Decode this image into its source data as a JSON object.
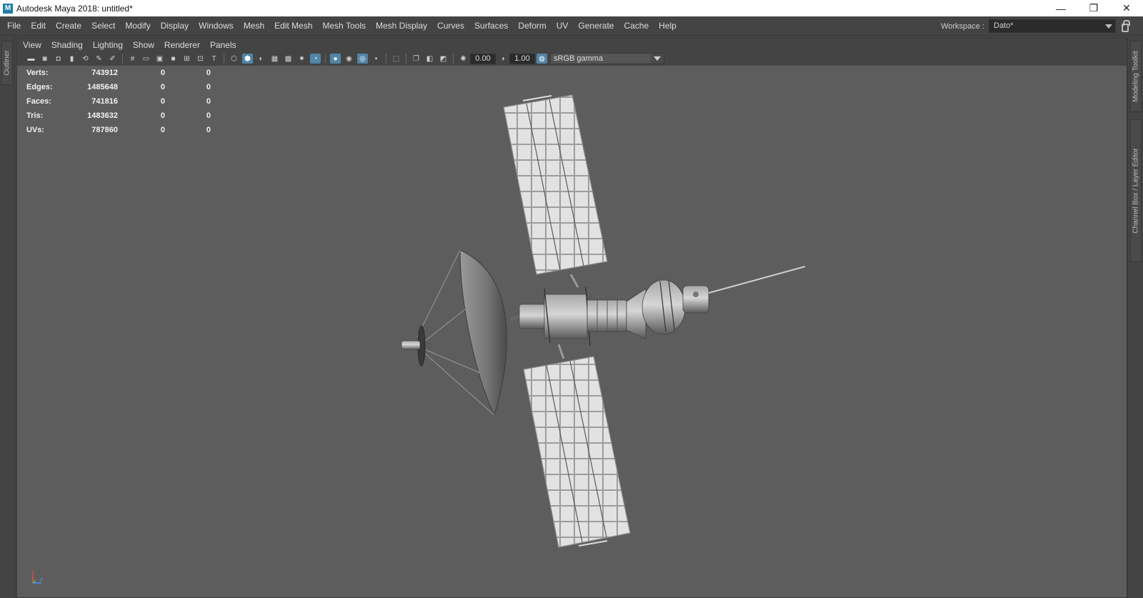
{
  "window": {
    "title": "Autodesk Maya 2018: untitled*",
    "logo_letter": "M",
    "minimize": "—",
    "maximize": "❐",
    "close": "✕"
  },
  "menubar": {
    "items": [
      "File",
      "Edit",
      "Create",
      "Select",
      "Modify",
      "Display",
      "Windows",
      "Mesh",
      "Edit Mesh",
      "Mesh Tools",
      "Mesh Display",
      "Curves",
      "Surfaces",
      "Deform",
      "UV",
      "Generate",
      "Cache",
      "Help"
    ],
    "workspace_label": "Workspace :",
    "workspace_value": "Dato*"
  },
  "left_strip": {
    "outliner_tab": "Outliner"
  },
  "right_strip": {
    "modeling_toolkit_tab": "Modeling Toolkit",
    "channel_box_tab": "Channel Box / Layer Editor"
  },
  "panel_menu": {
    "items": [
      "View",
      "Shading",
      "Lighting",
      "Show",
      "Renderer",
      "Panels"
    ]
  },
  "toolbar": {
    "exposure_value": "0.00",
    "gamma_value": "1.00",
    "color_space": "sRGB gamma"
  },
  "hud": {
    "rows": [
      {
        "label": "Verts:",
        "v1": "743912",
        "v2": "0",
        "v3": "0"
      },
      {
        "label": "Edges:",
        "v1": "1485648",
        "v2": "0",
        "v3": "0"
      },
      {
        "label": "Faces:",
        "v1": "741816",
        "v2": "0",
        "v3": "0"
      },
      {
        "label": "Tris:",
        "v1": "1483632",
        "v2": "0",
        "v3": "0"
      },
      {
        "label": "UVs:",
        "v1": "787860",
        "v2": "0",
        "v3": "0"
      }
    ]
  },
  "axis_indicator": {
    "x_label": "x",
    "z_label": "z"
  },
  "colors": {
    "viewport_bg": "#5d5d5d",
    "ui_bg": "#444444",
    "accent_active": "#5285a6"
  }
}
